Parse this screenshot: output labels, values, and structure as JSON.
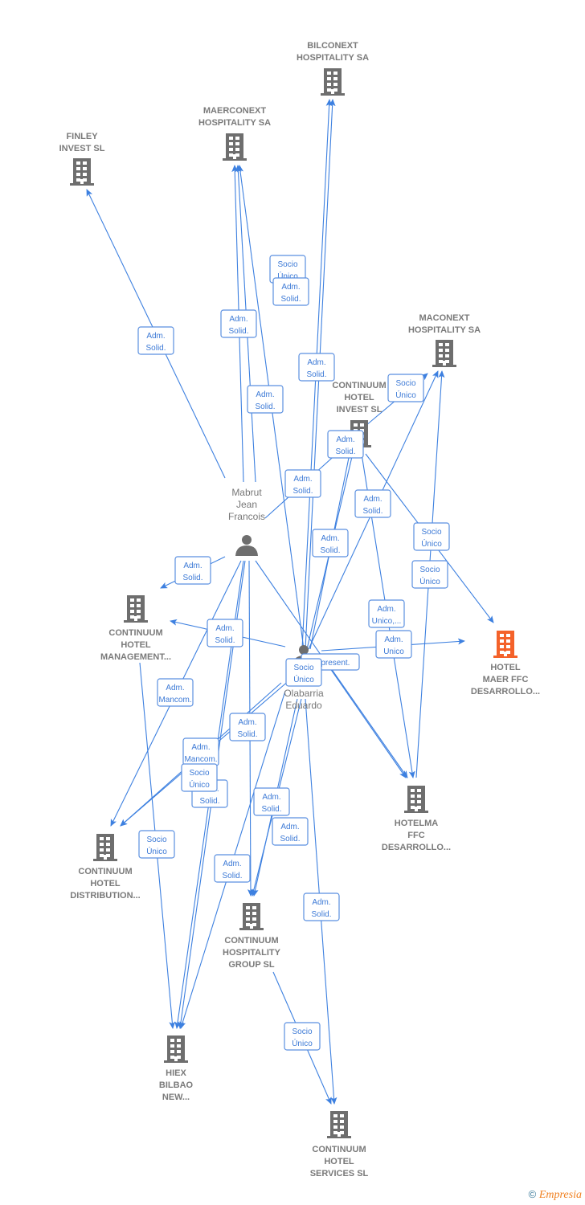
{
  "colors": {
    "edge": "#3d80e0",
    "company": "#6e6e6e",
    "highlight": "#f4622a",
    "label": "#7a7a7a"
  },
  "nodes": [
    {
      "id": "bilconext",
      "type": "company",
      "label": [
        "BILCONEXT",
        "HOSPITALITY SA"
      ]
    },
    {
      "id": "maerconext",
      "type": "company",
      "label": [
        "MAERCONEXT",
        "HOSPITALITY SA"
      ]
    },
    {
      "id": "finley",
      "type": "company",
      "label": [
        "FINLEY",
        "INVEST  SL"
      ]
    },
    {
      "id": "maconext",
      "type": "company",
      "label": [
        "MACONEXT",
        "HOSPITALITY SA"
      ]
    },
    {
      "id": "cont_invest",
      "type": "company",
      "label": [
        "CONTINUUM",
        "HOTEL",
        "INVEST  SL"
      ]
    },
    {
      "id": "mabrut",
      "type": "person",
      "label": [
        "Mabrut",
        "Jean",
        "Francois"
      ]
    },
    {
      "id": "olabarria",
      "type": "person",
      "label": [
        "Olabarria",
        "Eduardo"
      ]
    },
    {
      "id": "cont_mgmt",
      "type": "company",
      "label": [
        "CONTINUUM",
        "HOTEL",
        "MANAGEMENT..."
      ]
    },
    {
      "id": "hotel_maer",
      "type": "company",
      "highlight": true,
      "label": [
        "HOTEL",
        "MAER FFC",
        "DESARROLLO..."
      ]
    },
    {
      "id": "hotelma",
      "type": "company",
      "label": [
        "HOTELMA",
        "FFC",
        "DESARROLLO..."
      ]
    },
    {
      "id": "cont_dist",
      "type": "company",
      "label": [
        "CONTINUUM",
        "HOTEL",
        "DISTRIBUTION..."
      ]
    },
    {
      "id": "cont_group",
      "type": "company",
      "label": [
        "CONTINUUM",
        "HOSPITALITY",
        "GROUP  SL"
      ]
    },
    {
      "id": "hiex",
      "type": "company",
      "label": [
        "HIEX",
        "BILBAO",
        "NEW..."
      ]
    },
    {
      "id": "cont_services",
      "type": "company",
      "label": [
        "CONTINUUM",
        "HOTEL",
        "SERVICES SL"
      ]
    }
  ],
  "edges": [
    {
      "from": "mabrut",
      "to": "finley",
      "label": [
        "Adm.",
        "Solid."
      ]
    },
    {
      "from": "mabrut",
      "to": "maerconext",
      "label": [
        "Adm.",
        "Solid."
      ]
    },
    {
      "from": "mabrut",
      "to": "maerconext",
      "label": [
        "Adm.",
        "Solid."
      ]
    },
    {
      "from": "mabrut",
      "to": "cont_invest",
      "label": [
        "Adm.",
        "Solid."
      ]
    },
    {
      "from": "mabrut",
      "to": "cont_mgmt",
      "label": [
        "Adm.",
        "Solid."
      ]
    },
    {
      "from": "mabrut",
      "to": "cont_dist",
      "label": [
        "Adm.",
        "Mancom."
      ]
    },
    {
      "from": "mabrut",
      "to": "hiex",
      "label": [
        "Adm.",
        "Solid."
      ]
    },
    {
      "from": "mabrut",
      "to": "cont_group",
      "label": [
        "Adm.",
        "Solid."
      ]
    },
    {
      "from": "mabrut",
      "to": "hotelma",
      "label": []
    },
    {
      "from": "olabarria",
      "to": "bilconext",
      "label": [
        "Socio",
        "Único"
      ]
    },
    {
      "from": "olabarria",
      "to": "maerconext",
      "label": [
        "Adm.",
        "Solid."
      ]
    },
    {
      "from": "olabarria",
      "to": "bilconext",
      "label": [
        "Adm.",
        "Solid."
      ]
    },
    {
      "from": "olabarria",
      "to": "cont_invest",
      "label": [
        "Adm.",
        "Solid."
      ]
    },
    {
      "from": "olabarria",
      "to": "maconext",
      "label": [
        "Adm.",
        "Solid."
      ]
    },
    {
      "from": "olabarria",
      "to": "cont_invest",
      "label": [
        "Adm.",
        "Solid."
      ]
    },
    {
      "from": "olabarria",
      "to": "cont_mgmt",
      "label": [
        "Adm.",
        "Solid."
      ]
    },
    {
      "from": "olabarria",
      "to": "hotel_maer",
      "label": [
        "Adm.",
        "Unico"
      ]
    },
    {
      "from": "olabarria",
      "to": "hotelma",
      "label": [
        "Represent."
      ]
    },
    {
      "from": "olabarria",
      "to": "cont_dist",
      "label": [
        "Socio",
        "Único"
      ]
    },
    {
      "from": "olabarria",
      "to": "cont_dist",
      "label": [
        "Adm.",
        "Solid."
      ]
    },
    {
      "from": "olabarria",
      "to": "hiex",
      "label": [
        "Adm.",
        "Mancom."
      ]
    },
    {
      "from": "olabarria",
      "to": "cont_group",
      "label": [
        "Adm.",
        "Solid."
      ]
    },
    {
      "from": "olabarria",
      "to": "cont_group",
      "label": [
        "Adm.",
        "Solid."
      ]
    },
    {
      "from": "olabarria",
      "to": "cont_services",
      "label": [
        "Adm.",
        "Solid."
      ]
    },
    {
      "from": "mabrut",
      "to": "hiex",
      "label": [
        "Socio",
        "Único"
      ]
    },
    {
      "from": "cont_invest",
      "to": "maconext",
      "label": [
        "Socio",
        "Único"
      ]
    },
    {
      "from": "cont_invest",
      "to": "hotel_maer",
      "label": [
        "Socio",
        "Único"
      ]
    },
    {
      "from": "cont_invest",
      "to": "hotelma",
      "label": [
        "Adm.",
        "Unico,..."
      ]
    },
    {
      "from": "hotelma",
      "to": "maconext",
      "label": [
        "Socio",
        "Único"
      ]
    },
    {
      "from": "cont_mgmt",
      "to": "hiex",
      "label": [
        "Socio",
        "Único"
      ]
    },
    {
      "from": "cont_group",
      "to": "cont_services",
      "label": [
        "Socio",
        "Único"
      ]
    }
  ],
  "footer": {
    "copyright": "©",
    "brand": "Empresia"
  }
}
